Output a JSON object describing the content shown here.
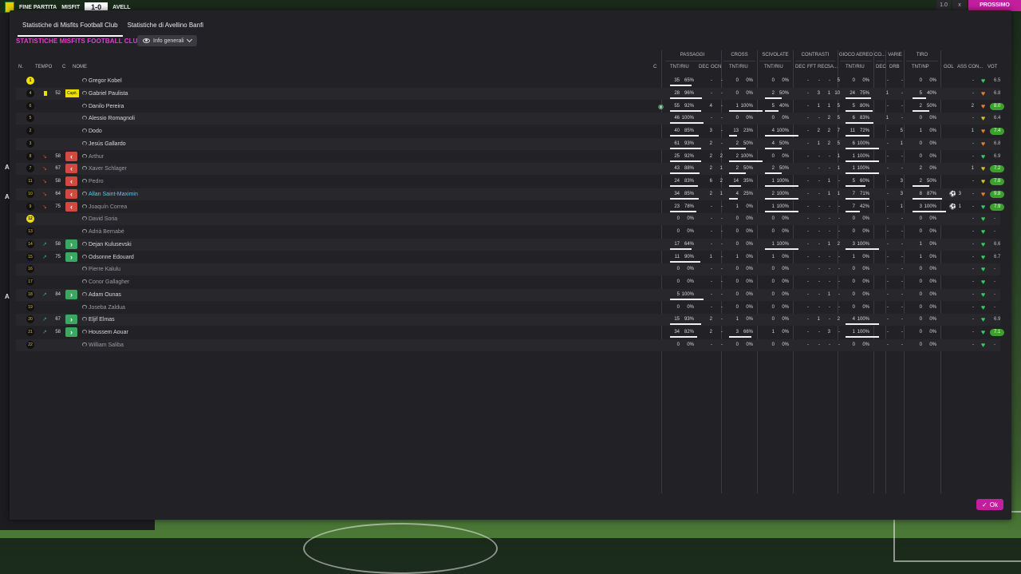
{
  "topbar": {
    "status": "FINE PARTITA",
    "home_abbr": "MISFIT",
    "score": "1-0",
    "away_abbr": "AVELL",
    "right_label": "PROSSIMO",
    "right_small_1": "1.0",
    "right_small_2": "x"
  },
  "tabs": [
    {
      "label": "Statistiche di Misfits Football Club",
      "active": true
    },
    {
      "label": "Statistiche di Avellino Banfi",
      "active": false
    }
  ],
  "team_title": "STATISTICHE MISFITS FOOTBALL CLUB",
  "view_dropdown": {
    "label": "Info generali"
  },
  "columns": {
    "n": "N.",
    "tempo": "TEMPO",
    "c": "C",
    "nome": "NOME",
    "c2": "C",
    "groups": {
      "passaggi": "PASSAGGI",
      "cross": "CROSS",
      "scivolate": "SCIVOLATE",
      "contrasti": "CONTRASTI",
      "gioco_aereo": "GIOCO AEREO",
      "co": "CO...",
      "varie": "VARIE",
      "tiro": "TIRO"
    },
    "sub": {
      "tnt_riu": "TNT/RIU",
      "dec": "DEC",
      "ocn": "OCN",
      "fft": "FFT",
      "rec": "REC",
      "sa": "SA...",
      "drb": "DRB",
      "tnt_unp": "TNT/NP",
      "gol": "GOL",
      "ass": "ASS",
      "con": "CON...",
      "vot": "VOT"
    }
  },
  "players": [
    {
      "num": "1",
      "gk": true,
      "name": "Gregor Kobel",
      "min": "",
      "card": "",
      "sub": "",
      "p_t": "35",
      "p_pct": "65%",
      "p_bar": 65,
      "p_dec": "-",
      "p_ocn": "-",
      "c_t": "0",
      "c_pct": "0%",
      "c_bar": 0,
      "s_t": "0",
      "s_pct": "0%",
      "s_bar": 0,
      "k_dec": "-",
      "k_fft": "-",
      "k_rec": "-",
      "k_sa": "5",
      "a_t": "0",
      "a_pct": "0%",
      "a_bar": 0,
      "co": "-",
      "v_drb": "-",
      "t_t": "0",
      "t_pct": "0%",
      "t_bar": 0,
      "gol": "",
      "ass": "-",
      "vote": "6.5",
      "vote_green": false,
      "heart": "green",
      "dim": false,
      "cyan": false
    },
    {
      "num": "4",
      "gk": false,
      "name": "Gabriel Paulista",
      "min": "52",
      "card": "yellow",
      "capt": "Capit.",
      "sub": "",
      "p_t": "28",
      "p_pct": "96%",
      "p_bar": 96,
      "p_dec": "-",
      "p_ocn": "-",
      "c_t": "0",
      "c_pct": "0%",
      "c_bar": 0,
      "s_t": "2",
      "s_pct": "50%",
      "s_bar": 50,
      "k_dec": "-",
      "k_fft": "3",
      "k_rec": "1",
      "k_sa": "10",
      "a_t": "24",
      "a_pct": "75%",
      "a_bar": 75,
      "co": "1",
      "v_drb": "-",
      "t_t": "5",
      "t_pct": "40%",
      "t_bar": 40,
      "gol": "",
      "ass": "-",
      "vote": "6.8",
      "vote_green": false,
      "heart": "orange",
      "dim": false,
      "cyan": false
    },
    {
      "num": "6",
      "gk": false,
      "name": "Danilo Pereira",
      "min": "",
      "card": "",
      "sub": "",
      "ball": true,
      "p_t": "55",
      "p_pct": "92%",
      "p_bar": 92,
      "p_dec": "4",
      "p_ocn": "-",
      "c_t": "1",
      "c_pct": "100%",
      "c_bar": 100,
      "s_t": "5",
      "s_pct": "40%",
      "s_bar": 40,
      "k_dec": "-",
      "k_fft": "1",
      "k_rec": "1",
      "k_sa": "5",
      "a_t": "5",
      "a_pct": "80%",
      "a_bar": 80,
      "co": "-",
      "v_drb": "-",
      "t_t": "2",
      "t_pct": "50%",
      "t_bar": 50,
      "gol": "",
      "ass": "2",
      "vote": "8.0",
      "vote_green": true,
      "heart": "orange",
      "dim": false,
      "cyan": false
    },
    {
      "num": "5",
      "gk": false,
      "name": "Alessio Romagnoli",
      "min": "",
      "card": "",
      "sub": "",
      "p_t": "46",
      "p_pct": "100%",
      "p_bar": 100,
      "p_dec": "-",
      "p_ocn": "-",
      "c_t": "0",
      "c_pct": "0%",
      "c_bar": 0,
      "s_t": "0",
      "s_pct": "0%",
      "s_bar": 0,
      "k_dec": "-",
      "k_fft": "-",
      "k_rec": "2",
      "k_sa": "5",
      "a_t": "6",
      "a_pct": "83%",
      "a_bar": 83,
      "co": "1",
      "v_drb": "-",
      "t_t": "0",
      "t_pct": "0%",
      "t_bar": 0,
      "gol": "",
      "ass": "-",
      "vote": "6.4",
      "vote_green": false,
      "heart": "yellow",
      "dim": false,
      "cyan": false
    },
    {
      "num": "2",
      "gk": false,
      "name": "Dodo",
      "min": "",
      "card": "",
      "sub": "",
      "p_t": "40",
      "p_pct": "85%",
      "p_bar": 85,
      "p_dec": "3",
      "p_ocn": "-",
      "c_t": "13",
      "c_pct": "23%",
      "c_bar": 23,
      "s_t": "4",
      "s_pct": "100%",
      "s_bar": 100,
      "k_dec": "-",
      "k_fft": "2",
      "k_rec": "2",
      "k_sa": "7",
      "a_t": "11",
      "a_pct": "72%",
      "a_bar": 72,
      "co": "-",
      "v_drb": "5",
      "t_t": "1",
      "t_pct": "0%",
      "t_bar": 0,
      "gol": "",
      "ass": "1",
      "vote": "7.4",
      "vote_green": true,
      "heart": "orange",
      "dim": false,
      "cyan": false
    },
    {
      "num": "3",
      "gk": false,
      "name": "Jesús Gallardo",
      "min": "",
      "card": "",
      "sub": "",
      "p_t": "61",
      "p_pct": "93%",
      "p_bar": 93,
      "p_dec": "2",
      "p_ocn": "-",
      "c_t": "2",
      "c_pct": "50%",
      "c_bar": 50,
      "s_t": "4",
      "s_pct": "50%",
      "s_bar": 50,
      "k_dec": "-",
      "k_fft": "1",
      "k_rec": "2",
      "k_sa": "5",
      "a_t": "6",
      "a_pct": "100%",
      "a_bar": 100,
      "co": "-",
      "v_drb": "1",
      "t_t": "0",
      "t_pct": "0%",
      "t_bar": 0,
      "gol": "",
      "ass": "-",
      "vote": "6.8",
      "vote_green": false,
      "heart": "orange",
      "dim": false,
      "cyan": false
    },
    {
      "num": "8",
      "gk": false,
      "name": "Arthur",
      "min": "58",
      "card": "",
      "sub": "out",
      "p_t": "25",
      "p_pct": "92%",
      "p_bar": 92,
      "p_dec": "2",
      "p_ocn": "2",
      "c_t": "2",
      "c_pct": "100%",
      "c_bar": 100,
      "s_t": "0",
      "s_pct": "0%",
      "s_bar": 0,
      "k_dec": "-",
      "k_fft": "-",
      "k_rec": "-",
      "k_sa": "1",
      "a_t": "1",
      "a_pct": "100%",
      "a_bar": 100,
      "co": "-",
      "v_drb": "-",
      "t_t": "0",
      "t_pct": "0%",
      "t_bar": 0,
      "gol": "",
      "ass": "-",
      "vote": "6.9",
      "vote_green": false,
      "heart": "green",
      "dim": true,
      "cyan": false
    },
    {
      "num": "7",
      "gk": false,
      "name": "Xaver Schlager",
      "min": "67",
      "card": "",
      "sub": "out",
      "p_t": "43",
      "p_pct": "88%",
      "p_bar": 88,
      "p_dec": "2",
      "p_ocn": "1",
      "c_t": "2",
      "c_pct": "50%",
      "c_bar": 50,
      "s_t": "2",
      "s_pct": "50%",
      "s_bar": 50,
      "k_dec": "-",
      "k_fft": "-",
      "k_rec": "-",
      "k_sa": "1",
      "a_t": "1",
      "a_pct": "100%",
      "a_bar": 100,
      "co": "-",
      "v_drb": "-",
      "t_t": "2",
      "t_pct": "0%",
      "t_bar": 0,
      "gol": "",
      "ass": "1",
      "vote": "7.2",
      "vote_green": true,
      "heart": "yellow",
      "dim": true,
      "cyan": false
    },
    {
      "num": "11",
      "gk": false,
      "name": "Pedro",
      "min": "58",
      "card": "",
      "sub": "out",
      "p_t": "24",
      "p_pct": "83%",
      "p_bar": 83,
      "p_dec": "6",
      "p_ocn": "2",
      "c_t": "14",
      "c_pct": "35%",
      "c_bar": 35,
      "s_t": "1",
      "s_pct": "100%",
      "s_bar": 100,
      "k_dec": "-",
      "k_fft": "-",
      "k_rec": "1",
      "k_sa": "-",
      "a_t": "5",
      "a_pct": "60%",
      "a_bar": 60,
      "co": "-",
      "v_drb": "3",
      "t_t": "2",
      "t_pct": "50%",
      "t_bar": 50,
      "gol": "",
      "ass": "-",
      "vote": "7.8",
      "vote_green": true,
      "heart": "yellow",
      "dim": true,
      "cyan": false
    },
    {
      "num": "10",
      "gk": false,
      "name": "Allan Saint-Maximin",
      "min": "64",
      "card": "",
      "sub": "out",
      "p_t": "34",
      "p_pct": "85%",
      "p_bar": 85,
      "p_dec": "2",
      "p_ocn": "1",
      "c_t": "4",
      "c_pct": "25%",
      "c_bar": 25,
      "s_t": "2",
      "s_pct": "100%",
      "s_bar": 100,
      "k_dec": "-",
      "k_fft": "-",
      "k_rec": "1",
      "k_sa": "1",
      "a_t": "7",
      "a_pct": "71%",
      "a_bar": 71,
      "co": "-",
      "v_drb": "3",
      "t_t": "8",
      "t_pct": "87%",
      "t_bar": 87,
      "gol": "3",
      "ass": "-",
      "vote": "9.8",
      "vote_green": true,
      "heart": "orange",
      "dim": false,
      "cyan": true
    },
    {
      "num": "9",
      "gk": false,
      "name": "Joaquín Correa",
      "min": "75",
      "card": "",
      "sub": "out",
      "p_t": "23",
      "p_pct": "78%",
      "p_bar": 78,
      "p_dec": "-",
      "p_ocn": "-",
      "c_t": "1",
      "c_pct": "0%",
      "c_bar": 0,
      "s_t": "1",
      "s_pct": "100%",
      "s_bar": 100,
      "k_dec": "-",
      "k_fft": "-",
      "k_rec": "-",
      "k_sa": "-",
      "a_t": "7",
      "a_pct": "42%",
      "a_bar": 42,
      "co": "-",
      "v_drb": "1",
      "t_t": "3",
      "t_pct": "100%",
      "t_bar": 100,
      "gol": "1",
      "ass": "-",
      "vote": "7.9",
      "vote_green": true,
      "heart": "green",
      "dim": true,
      "cyan": false
    },
    {
      "num": "12",
      "gk": true,
      "name": "David Soria",
      "min": "",
      "card": "",
      "sub": "",
      "p_t": "0",
      "p_pct": "0%",
      "p_bar": 0,
      "p_dec": "-",
      "p_ocn": "-",
      "c_t": "0",
      "c_pct": "0%",
      "c_bar": 0,
      "s_t": "0",
      "s_pct": "0%",
      "s_bar": 0,
      "k_dec": "-",
      "k_fft": "-",
      "k_rec": "-",
      "k_sa": "-",
      "a_t": "0",
      "a_pct": "0%",
      "a_bar": 0,
      "co": "-",
      "v_drb": "-",
      "t_t": "0",
      "t_pct": "0%",
      "t_bar": 0,
      "gol": "",
      "ass": "-",
      "vote": "-",
      "vote_green": false,
      "heart": "green",
      "dim": true,
      "cyan": false
    },
    {
      "num": "13",
      "gk": false,
      "name": "Adrià Bernabé",
      "min": "",
      "card": "",
      "sub": "",
      "p_t": "0",
      "p_pct": "0%",
      "p_bar": 0,
      "p_dec": "-",
      "p_ocn": "-",
      "c_t": "0",
      "c_pct": "0%",
      "c_bar": 0,
      "s_t": "0",
      "s_pct": "0%",
      "s_bar": 0,
      "k_dec": "-",
      "k_fft": "-",
      "k_rec": "-",
      "k_sa": "-",
      "a_t": "0",
      "a_pct": "0%",
      "a_bar": 0,
      "co": "-",
      "v_drb": "-",
      "t_t": "0",
      "t_pct": "0%",
      "t_bar": 0,
      "gol": "",
      "ass": "-",
      "vote": "-",
      "vote_green": false,
      "heart": "green",
      "dim": true,
      "cyan": false
    },
    {
      "num": "14",
      "gk": false,
      "name": "Dejan Kulusevski",
      "min": "58",
      "card": "",
      "sub": "in",
      "p_t": "17",
      "p_pct": "64%",
      "p_bar": 64,
      "p_dec": "-",
      "p_ocn": "-",
      "c_t": "0",
      "c_pct": "0%",
      "c_bar": 0,
      "s_t": "1",
      "s_pct": "100%",
      "s_bar": 100,
      "k_dec": "-",
      "k_fft": "-",
      "k_rec": "1",
      "k_sa": "2",
      "a_t": "3",
      "a_pct": "100%",
      "a_bar": 100,
      "co": "-",
      "v_drb": "-",
      "t_t": "1",
      "t_pct": "0%",
      "t_bar": 0,
      "gol": "",
      "ass": "-",
      "vote": "6.6",
      "vote_green": false,
      "heart": "green",
      "dim": false,
      "cyan": false
    },
    {
      "num": "15",
      "gk": false,
      "name": "Odsonne Edouard",
      "min": "75",
      "card": "",
      "sub": "in",
      "p_t": "11",
      "p_pct": "90%",
      "p_bar": 90,
      "p_dec": "1",
      "p_ocn": "-",
      "c_t": "1",
      "c_pct": "0%",
      "c_bar": 0,
      "s_t": "1",
      "s_pct": "0%",
      "s_bar": 0,
      "k_dec": "-",
      "k_fft": "-",
      "k_rec": "-",
      "k_sa": "-",
      "a_t": "1",
      "a_pct": "0%",
      "a_bar": 0,
      "co": "-",
      "v_drb": "-",
      "t_t": "1",
      "t_pct": "0%",
      "t_bar": 0,
      "gol": "",
      "ass": "-",
      "vote": "6.7",
      "vote_green": false,
      "heart": "green",
      "dim": false,
      "cyan": false
    },
    {
      "num": "16",
      "gk": false,
      "name": "Pierre Kalulu",
      "min": "",
      "card": "",
      "sub": "",
      "p_t": "0",
      "p_pct": "0%",
      "p_bar": 0,
      "p_dec": "-",
      "p_ocn": "-",
      "c_t": "0",
      "c_pct": "0%",
      "c_bar": 0,
      "s_t": "0",
      "s_pct": "0%",
      "s_bar": 0,
      "k_dec": "-",
      "k_fft": "-",
      "k_rec": "-",
      "k_sa": "-",
      "a_t": "0",
      "a_pct": "0%",
      "a_bar": 0,
      "co": "-",
      "v_drb": "-",
      "t_t": "0",
      "t_pct": "0%",
      "t_bar": 0,
      "gol": "",
      "ass": "-",
      "vote": "-",
      "vote_green": false,
      "heart": "green",
      "dim": true,
      "cyan": false
    },
    {
      "num": "17",
      "gk": false,
      "name": "Conor Gallagher",
      "min": "",
      "card": "",
      "sub": "",
      "p_t": "0",
      "p_pct": "0%",
      "p_bar": 0,
      "p_dec": "-",
      "p_ocn": "-",
      "c_t": "0",
      "c_pct": "0%",
      "c_bar": 0,
      "s_t": "0",
      "s_pct": "0%",
      "s_bar": 0,
      "k_dec": "-",
      "k_fft": "-",
      "k_rec": "-",
      "k_sa": "-",
      "a_t": "0",
      "a_pct": "0%",
      "a_bar": 0,
      "co": "-",
      "v_drb": "-",
      "t_t": "0",
      "t_pct": "0%",
      "t_bar": 0,
      "gol": "",
      "ass": "-",
      "vote": "-",
      "vote_green": false,
      "heart": "green",
      "dim": true,
      "cyan": false
    },
    {
      "num": "18",
      "gk": false,
      "name": "Adam Ounas",
      "min": "84",
      "card": "",
      "sub": "in",
      "p_t": "5",
      "p_pct": "100%",
      "p_bar": 100,
      "p_dec": "-",
      "p_ocn": "-",
      "c_t": "0",
      "c_pct": "0%",
      "c_bar": 0,
      "s_t": "0",
      "s_pct": "0%",
      "s_bar": 0,
      "k_dec": "-",
      "k_fft": "-",
      "k_rec": "1",
      "k_sa": "-",
      "a_t": "0",
      "a_pct": "0%",
      "a_bar": 0,
      "co": "-",
      "v_drb": "-",
      "t_t": "0",
      "t_pct": "0%",
      "t_bar": 0,
      "gol": "",
      "ass": "-",
      "vote": "-",
      "vote_green": false,
      "heart": "green",
      "dim": false,
      "cyan": false
    },
    {
      "num": "19",
      "gk": false,
      "name": "Joseba Zaldua",
      "min": "",
      "card": "",
      "sub": "",
      "p_t": "0",
      "p_pct": "0%",
      "p_bar": 0,
      "p_dec": "-",
      "p_ocn": "-",
      "c_t": "0",
      "c_pct": "0%",
      "c_bar": 0,
      "s_t": "0",
      "s_pct": "0%",
      "s_bar": 0,
      "k_dec": "-",
      "k_fft": "-",
      "k_rec": "-",
      "k_sa": "-",
      "a_t": "0",
      "a_pct": "0%",
      "a_bar": 0,
      "co": "-",
      "v_drb": "-",
      "t_t": "0",
      "t_pct": "0%",
      "t_bar": 0,
      "gol": "",
      "ass": "-",
      "vote": "-",
      "vote_green": false,
      "heart": "green",
      "dim": true,
      "cyan": false
    },
    {
      "num": "20",
      "gk": false,
      "name": "Eljif Elmas",
      "min": "67",
      "card": "",
      "sub": "in",
      "p_t": "15",
      "p_pct": "93%",
      "p_bar": 93,
      "p_dec": "2",
      "p_ocn": "-",
      "c_t": "1",
      "c_pct": "0%",
      "c_bar": 0,
      "s_t": "0",
      "s_pct": "0%",
      "s_bar": 0,
      "k_dec": "-",
      "k_fft": "1",
      "k_rec": "-",
      "k_sa": "2",
      "a_t": "4",
      "a_pct": "100%",
      "a_bar": 100,
      "co": "-",
      "v_drb": "-",
      "t_t": "0",
      "t_pct": "0%",
      "t_bar": 0,
      "gol": "",
      "ass": "-",
      "vote": "6.9",
      "vote_green": false,
      "heart": "green",
      "dim": false,
      "cyan": false
    },
    {
      "num": "21",
      "gk": false,
      "name": "Houssem Aouar",
      "min": "58",
      "card": "",
      "sub": "in",
      "p_t": "34",
      "p_pct": "82%",
      "p_bar": 82,
      "p_dec": "2",
      "p_ocn": "-",
      "c_t": "3",
      "c_pct": "66%",
      "c_bar": 66,
      "s_t": "1",
      "s_pct": "0%",
      "s_bar": 0,
      "k_dec": "-",
      "k_fft": "-",
      "k_rec": "3",
      "k_sa": "-",
      "a_t": "1",
      "a_pct": "100%",
      "a_bar": 100,
      "co": "-",
      "v_drb": "-",
      "t_t": "0",
      "t_pct": "0%",
      "t_bar": 0,
      "gol": "",
      "ass": "-",
      "vote": "7.1",
      "vote_green": true,
      "heart": "green",
      "dim": false,
      "cyan": false
    },
    {
      "num": "22",
      "gk": false,
      "name": "William Saliba",
      "min": "",
      "card": "",
      "sub": "",
      "p_t": "0",
      "p_pct": "0%",
      "p_bar": 0,
      "p_dec": "-",
      "p_ocn": "-",
      "c_t": "0",
      "c_pct": "0%",
      "c_bar": 0,
      "s_t": "0",
      "s_pct": "0%",
      "s_bar": 0,
      "k_dec": "-",
      "k_fft": "-",
      "k_rec": "-",
      "k_sa": "-",
      "a_t": "0",
      "a_pct": "0%",
      "a_bar": 0,
      "co": "-",
      "v_drb": "-",
      "t_t": "0",
      "t_pct": "0%",
      "t_bar": 0,
      "gol": "",
      "ass": "-",
      "vote": "-",
      "vote_green": false,
      "heart": "green",
      "dim": true,
      "cyan": false
    }
  ],
  "ok_button": {
    "label": "Ok"
  },
  "colors": {
    "accent": "#c21e9d",
    "title": "#e040c8",
    "vote_green": "#3ca02c",
    "heart_green": "#3ac86a",
    "heart_orange": "#e0802a",
    "heart_yellow": "#d8c020"
  }
}
